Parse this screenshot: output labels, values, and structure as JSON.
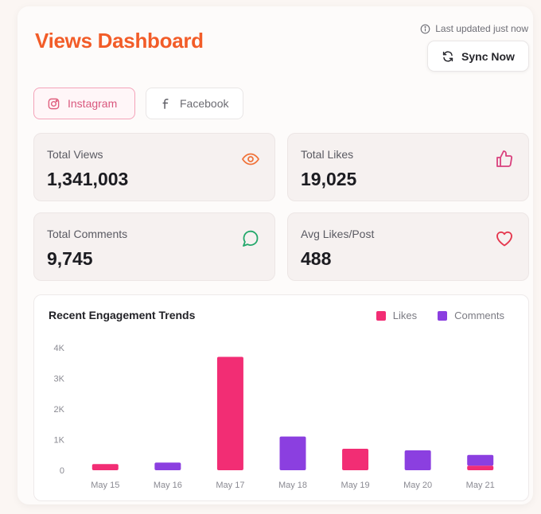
{
  "header": {
    "title": "Views Dashboard",
    "last_updated": "Last updated just now",
    "sync_label": "Sync Now"
  },
  "tabs": [
    {
      "label": "Instagram",
      "icon": "instagram-icon",
      "active": true
    },
    {
      "label": "Facebook",
      "icon": "facebook-icon",
      "active": false
    }
  ],
  "stats": [
    {
      "label": "Total Views",
      "value": "1,341,003",
      "icon": "eye-icon",
      "color": "#f0733a"
    },
    {
      "label": "Total Likes",
      "value": "19,025",
      "icon": "thumbs-up-icon",
      "color": "#d9407d"
    },
    {
      "label": "Total Comments",
      "value": "9,745",
      "icon": "message-circle-icon",
      "color": "#24a86b"
    },
    {
      "label": "Avg Likes/Post",
      "value": "488",
      "icon": "heart-icon",
      "color": "#e5374e"
    }
  ],
  "chart": {
    "title": "Recent Engagement Trends"
  },
  "chart_data": {
    "type": "bar",
    "stacked": true,
    "categories": [
      "May 15",
      "May 16",
      "May 17",
      "May 18",
      "May 19",
      "May 20",
      "May 21"
    ],
    "series": [
      {
        "name": "Likes",
        "color": "#f22d74",
        "values": [
          200,
          0,
          3700,
          0,
          700,
          0,
          150
        ]
      },
      {
        "name": "Comments",
        "color": "#8b3fe0",
        "values": [
          0,
          250,
          0,
          1100,
          0,
          650,
          350
        ]
      }
    ],
    "yticks": [
      "0",
      "1K",
      "2K",
      "3K",
      "4K"
    ],
    "ylim": [
      0,
      4000
    ],
    "grid": false,
    "legend": "top-right"
  }
}
